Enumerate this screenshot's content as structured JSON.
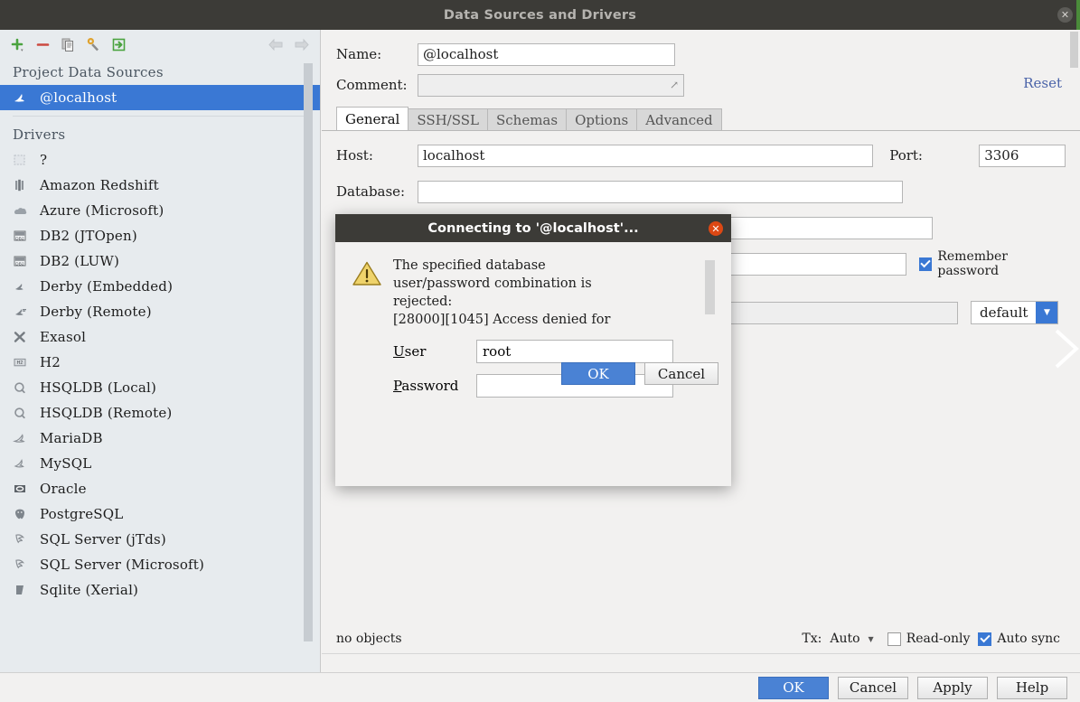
{
  "window": {
    "title": "Data Sources and Drivers",
    "close_icon": "close-icon"
  },
  "toolbar": {
    "add_label": "+",
    "remove_label": "−",
    "copy_icon": "copy-icon",
    "settings_icon": "wrench-icon",
    "import_icon": "import-icon",
    "back_icon": "arrow-left-icon",
    "forward_icon": "arrow-right-icon"
  },
  "sidebar": {
    "project_group_label": "Project Data Sources",
    "project_items": [
      {
        "label": "@localhost",
        "icon": "mysql-dolphin-icon",
        "selected": true
      }
    ],
    "drivers_group_label": "Drivers",
    "drivers": [
      {
        "label": "?",
        "icon": "unknown-driver-icon"
      },
      {
        "label": "Amazon Redshift",
        "icon": "redshift-icon"
      },
      {
        "label": "Azure (Microsoft)",
        "icon": "azure-icon"
      },
      {
        "label": "DB2 (JTOpen)",
        "icon": "db2-icon"
      },
      {
        "label": "DB2 (LUW)",
        "icon": "db2-icon"
      },
      {
        "label": "Derby (Embedded)",
        "icon": "derby-icon"
      },
      {
        "label": "Derby (Remote)",
        "icon": "derby-icon"
      },
      {
        "label": "Exasol",
        "icon": "exasol-icon"
      },
      {
        "label": "H2",
        "icon": "h2-icon"
      },
      {
        "label": "HSQLDB (Local)",
        "icon": "hsqldb-icon"
      },
      {
        "label": "HSQLDB (Remote)",
        "icon": "hsqldb-icon"
      },
      {
        "label": "MariaDB",
        "icon": "mariadb-icon"
      },
      {
        "label": "MySQL",
        "icon": "mysql-dolphin-icon"
      },
      {
        "label": "Oracle",
        "icon": "oracle-icon"
      },
      {
        "label": "PostgreSQL",
        "icon": "postgresql-icon"
      },
      {
        "label": "SQL Server (jTds)",
        "icon": "sqlserver-icon"
      },
      {
        "label": "SQL Server (Microsoft)",
        "icon": "sqlserver-icon"
      },
      {
        "label": "Sqlite (Xerial)",
        "icon": "sqlite-icon"
      }
    ]
  },
  "details": {
    "name_label": "Name:",
    "name_value": "@localhost",
    "comment_label": "Comment:",
    "comment_value": "",
    "expand_icon": "expand-icon",
    "reset_label": "Reset",
    "tabs": [
      {
        "label": "General",
        "active": true
      },
      {
        "label": "SSH/SSL",
        "active": false
      },
      {
        "label": "Schemas",
        "active": false
      },
      {
        "label": "Options",
        "active": false
      },
      {
        "label": "Advanced",
        "active": false
      }
    ],
    "host_label": "Host:",
    "host_value": "localhost",
    "port_label": "Port:",
    "port_value": "3306",
    "database_label": "Database:",
    "database_value": "",
    "remember_password_label": "Remember password",
    "remember_password_checked": true,
    "charset_value": "default",
    "charset_arrow_icon": "chevron-down-icon"
  },
  "status": {
    "objects_text": "no objects",
    "tx_label": "Tx:",
    "tx_value": "Auto",
    "tx_arrow_icon": "chevron-down-icon",
    "readonly_label": "Read-only",
    "readonly_checked": false,
    "autosync_label": "Auto sync",
    "autosync_checked": true
  },
  "bottom_buttons": {
    "ok": "OK",
    "cancel": "Cancel",
    "apply": "Apply",
    "help": "Help"
  },
  "dialog": {
    "title": "Connecting to '@localhost'...",
    "close_icon": "close-icon",
    "warning_icon": "warning-triangle-icon",
    "message": "The specified database\nuser/password combination is\nrejected:\n[28000][1045] Access denied for\nuser 'root'@'localhost' (using",
    "user_label": "User",
    "user_value": "root",
    "password_label": "Password",
    "password_value": "",
    "ok_label": "OK",
    "cancel_label": "Cancel"
  },
  "colors": {
    "accent_blue": "#3a78d4",
    "titlebar": "#3c3b37",
    "sidebar_bg": "#e7ebee",
    "panel_bg": "#f2f1f0",
    "warning_yellow": "#e8c64a",
    "close_orange": "#dd4814"
  }
}
